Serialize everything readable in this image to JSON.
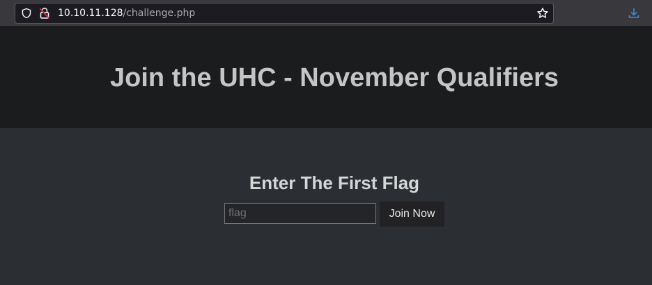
{
  "browser": {
    "url_host": "10.10.11.128",
    "url_path": "/challenge.php",
    "icons": {
      "shield": "shield-icon",
      "lock": "insecure-lock-icon",
      "star": "bookmark-star-icon",
      "download": "download-icon"
    },
    "colors": {
      "lock_accent": "#e22850",
      "download_accent": "#3d8bd8"
    }
  },
  "header": {
    "title": "Join the UHC - November Qualifiers"
  },
  "form": {
    "heading": "Enter The First Flag",
    "input_placeholder": "flag",
    "input_value": "",
    "button_label": "Join Now"
  }
}
